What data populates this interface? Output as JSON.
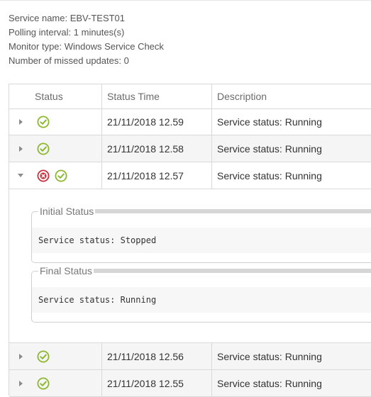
{
  "info": {
    "service_name": "Service name: EBV-TEST01",
    "polling_interval": "Polling interval: 1 minutes(s)",
    "monitor_type": "Monitor type: Windows Service Check",
    "missed_updates": "Number of missed updates: 0"
  },
  "table": {
    "columns": [
      "Status",
      "Status Time",
      "Description"
    ],
    "rows": [
      {
        "expanded": false,
        "icons": [
          "ok-icon"
        ],
        "time": "21/11/2018 12.59",
        "description": "Service status: Running"
      },
      {
        "expanded": false,
        "icons": [
          "ok-icon"
        ],
        "time": "21/11/2018 12.58",
        "description": "Service status: Running"
      },
      {
        "expanded": true,
        "icons": [
          "error-icon",
          "ok-icon"
        ],
        "time": "21/11/2018 12.57",
        "description": "Service status: Running"
      },
      {
        "expanded": false,
        "icons": [
          "ok-icon"
        ],
        "time": "21/11/2018 12.56",
        "description": "Service status: Running"
      },
      {
        "expanded": false,
        "icons": [
          "ok-icon"
        ],
        "time": "21/11/2018 12.55",
        "description": "Service status: Running"
      }
    ],
    "detail": {
      "initial_label": "Initial Status",
      "initial_value": "Service status: Stopped",
      "final_label": "Final Status",
      "final_value": "Service status: Running"
    }
  },
  "colors": {
    "ok": "#8cb82e",
    "error": "#c9303e",
    "border": "#d9d9d9",
    "alt_row": "#f5f5f5"
  }
}
